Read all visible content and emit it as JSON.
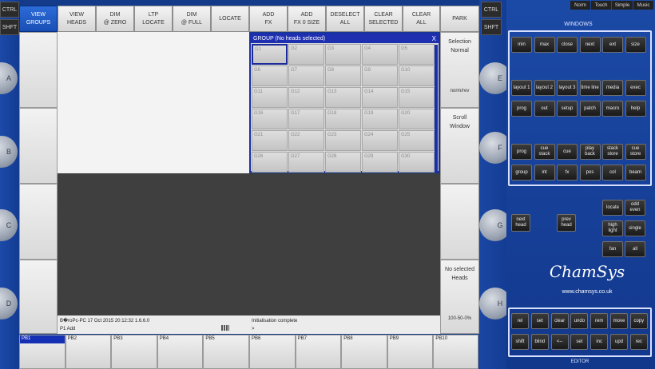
{
  "left_side": {
    "ctrl": "CTRL",
    "shft": "SHFT",
    "knobs": [
      "A",
      "B",
      "C",
      "D"
    ]
  },
  "right_side": {
    "ctrl": "CTRL",
    "shft": "SHFT",
    "knobs": [
      "E",
      "F",
      "G",
      "H"
    ]
  },
  "toolbar": [
    {
      "label": "VIEW\nGROUPS",
      "active": true
    },
    {
      "label": "VIEW\nHEADS",
      "active": false
    },
    {
      "label": "DIM\n@ ZERO",
      "active": false
    },
    {
      "label": "LTP\nLOCATE",
      "active": false
    },
    {
      "label": "DIM\n@ FULL",
      "active": false
    },
    {
      "label": "LOCATE",
      "active": false
    },
    {
      "label": "ADD\nFX",
      "active": false
    },
    {
      "label": "ADD\nFX 0 SIZE",
      "active": false
    },
    {
      "label": "DESELECT\nALL",
      "active": false
    },
    {
      "label": "CLEAR\nSELECTED",
      "active": false
    },
    {
      "label": "CLEAR\nALL",
      "active": false
    },
    {
      "label": "PARK",
      "active": false
    }
  ],
  "group_window": {
    "title": "GROUP (No heads selected)",
    "close": "X",
    "cells": [
      "G1",
      "G2",
      "G3",
      "G4",
      "G5",
      "G6",
      "G7",
      "G8",
      "G9",
      "G10",
      "G11",
      "G12",
      "G13",
      "G14",
      "G15",
      "G16",
      "G17",
      "G18",
      "G19",
      "G20",
      "G21",
      "G22",
      "G23",
      "G24",
      "G25",
      "G26",
      "G27",
      "G28",
      "G29",
      "G30"
    ]
  },
  "right_softkeys": {
    "selection": "Selection",
    "normal": "Normal",
    "norm_rev": "norm/rev",
    "scroll": "Scroll",
    "window": "Window",
    "no_selected": "No selected",
    "heads": "Heads",
    "level": "100-50-0%"
  },
  "status": {
    "left_line1": "B�roPc-PC 17 Oct 2015 20:12:32 1.6.6.0",
    "left_line2": "P1 Add",
    "right_line1": "Initialisation complete",
    "right_line2": ">"
  },
  "playbacks": [
    "PB1",
    "PB2",
    "PB3",
    "PB4",
    "PB5",
    "PB6",
    "PB7",
    "PB8",
    "PB9",
    "PB10"
  ],
  "top_tabs": [
    "Norm",
    "Touch",
    "Simple",
    "Music"
  ],
  "windows_label": "WINDOWS",
  "windows_buttons": [
    [
      "min",
      "max",
      "close",
      "next",
      "ext",
      "size"
    ],
    [
      "layout 1",
      "layout 2",
      "layout 3",
      "time line",
      "media",
      "exec"
    ],
    [
      "prog",
      "out",
      "setup",
      "patch",
      "macro",
      "help"
    ],
    [
      "prog",
      "cue stack",
      "cue",
      "play back",
      "stack store",
      "cue store"
    ],
    [
      "group",
      "int",
      "fx",
      "pos",
      "col",
      "beam"
    ]
  ],
  "mid_buttons": {
    "next_head": "next\nhead",
    "prev_head": "prev\nhead",
    "locate": "locate",
    "odd_even": "odd even",
    "high_light": "high light",
    "single": "single",
    "fan": "fan",
    "all": "all"
  },
  "brand": {
    "logo": "ChamSys",
    "url": "www.chamsys.co.uk"
  },
  "editor_buttons": [
    [
      "rel",
      "set",
      "clear",
      "undo",
      "rem",
      "move",
      "copy"
    ],
    [
      "shift",
      "blind",
      "<--",
      "set",
      "inc",
      "upd",
      "rec"
    ]
  ],
  "editor_label": "EDITOR"
}
